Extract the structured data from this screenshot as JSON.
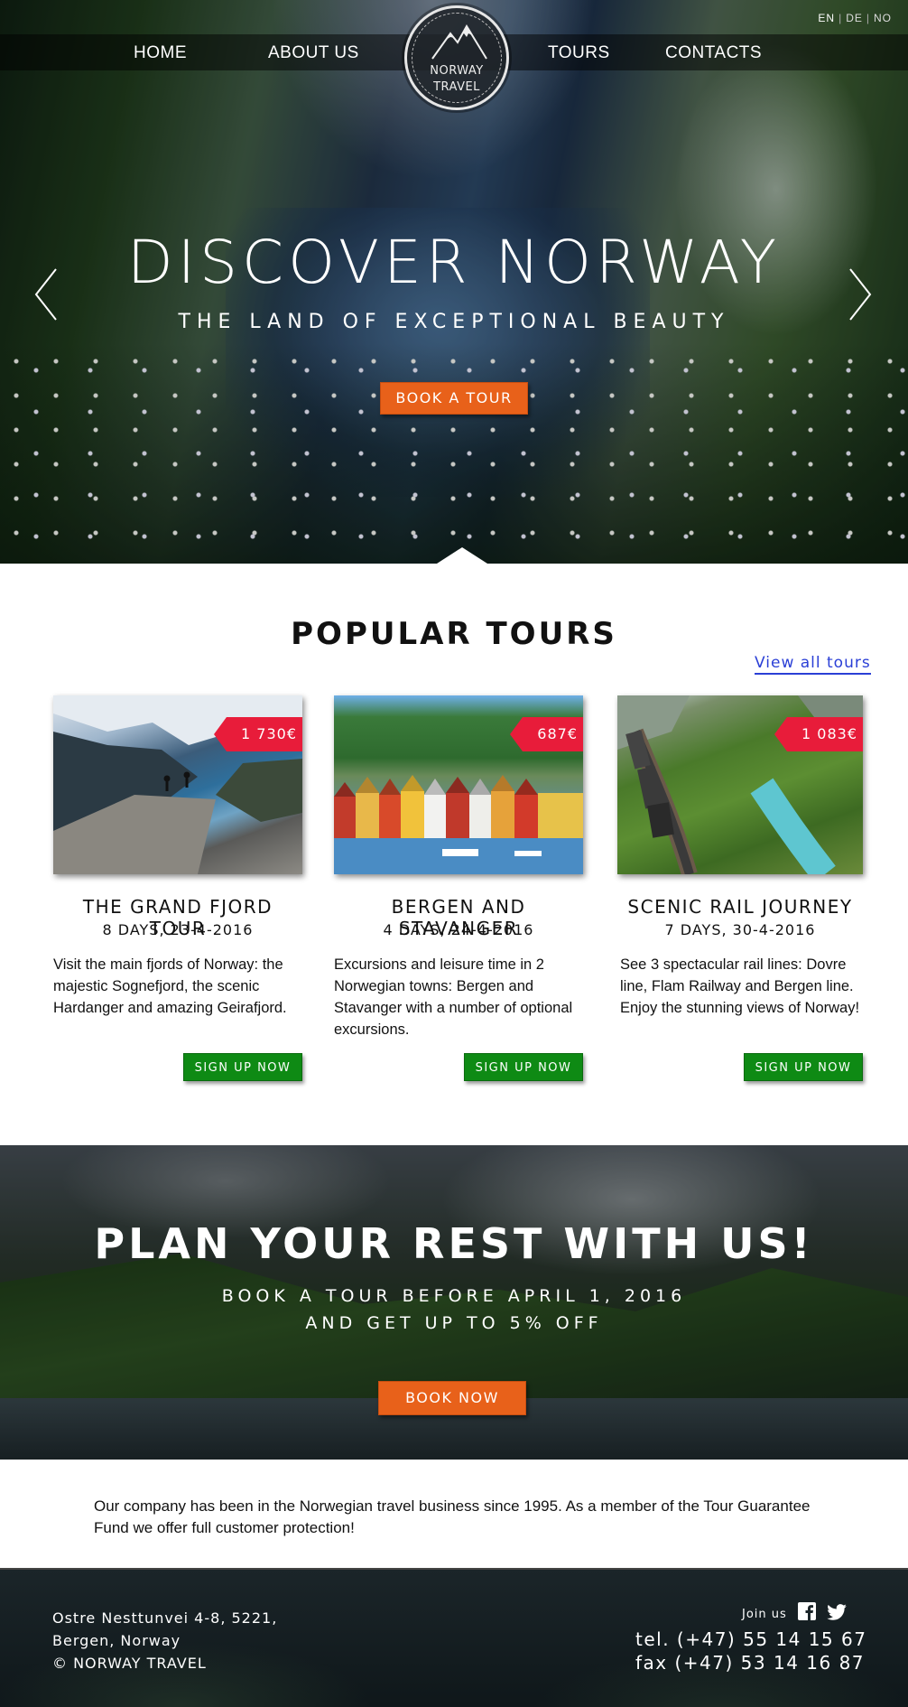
{
  "nav": {
    "home": "HOME",
    "about": "ABOUT US",
    "tours": "TOURS",
    "contacts": "CONTACTS"
  },
  "languages": {
    "en": "EN",
    "de": "DE",
    "no": "NO",
    "separator": "|"
  },
  "logo": {
    "line1": "NORWAY",
    "line2": "TRAVEL"
  },
  "hero": {
    "title": "DISCOVER NORWAY",
    "subtitle": "THE LAND OF EXCEPTIONAL BEAUTY",
    "cta": "BOOK A TOUR",
    "prev_icon": "chevron-left-icon",
    "next_icon": "chevron-right-icon"
  },
  "tours_section": {
    "title": "POPULAR TOURS",
    "view_all": "View all tours",
    "cards": [
      {
        "price": "1 730€",
        "title": "THE GRAND FJORD TOUR",
        "dates": "8 DAYS, 23-4-2016",
        "description": "Visit the main fjords of Norway: the majestic Sognefjord, the scenic Hardanger and amazing Geirafjord.",
        "button": "SIGN UP NOW"
      },
      {
        "price": "687€",
        "title": "BERGEN AND STAVANGER",
        "dates": "4 DAYS, 24-4-2016",
        "description": "Excursions and leisure time in 2 Norwegian towns: Bergen and Stavanger with a number of optional excursions.",
        "button": "SIGN UP NOW"
      },
      {
        "price": "1 083€",
        "title": "SCENIC RAIL JOURNEY",
        "dates": "7 DAYS, 30-4-2016",
        "description": "See 3 spectacular rail lines: Dovre line, Flam Railway and Bergen line. Enjoy the stunning views of Norway!",
        "button": "SIGN UP NOW"
      }
    ]
  },
  "promo": {
    "title": "PLAN YOUR REST WITH US!",
    "line1": "BOOK A TOUR BEFORE APRIL 1, 2016",
    "line2": "AND GET UP TO 5% OFF",
    "cta": "BOOK NOW"
  },
  "about": {
    "text": "Our company has been in the Norwegian travel business since 1995. As a member of the Tour Guarantee Fund we offer full customer protection!"
  },
  "footer": {
    "address1": "Ostre Nesttunvei 4-8, 5221,",
    "address2": "Bergen, Norway",
    "copyright": "© NORWAY TRAVEL",
    "join_us": "Join us",
    "tel": "tel. (+47) 55 14 15 67",
    "fax": "fax (+47) 53 14 16 87",
    "social_icons": [
      "facebook-icon",
      "twitter-icon"
    ]
  },
  "colors": {
    "accent_orange": "#e8611a",
    "price_red": "#e81c3a",
    "signup_green": "#0e8a14",
    "link_blue": "#2a3fd6"
  }
}
